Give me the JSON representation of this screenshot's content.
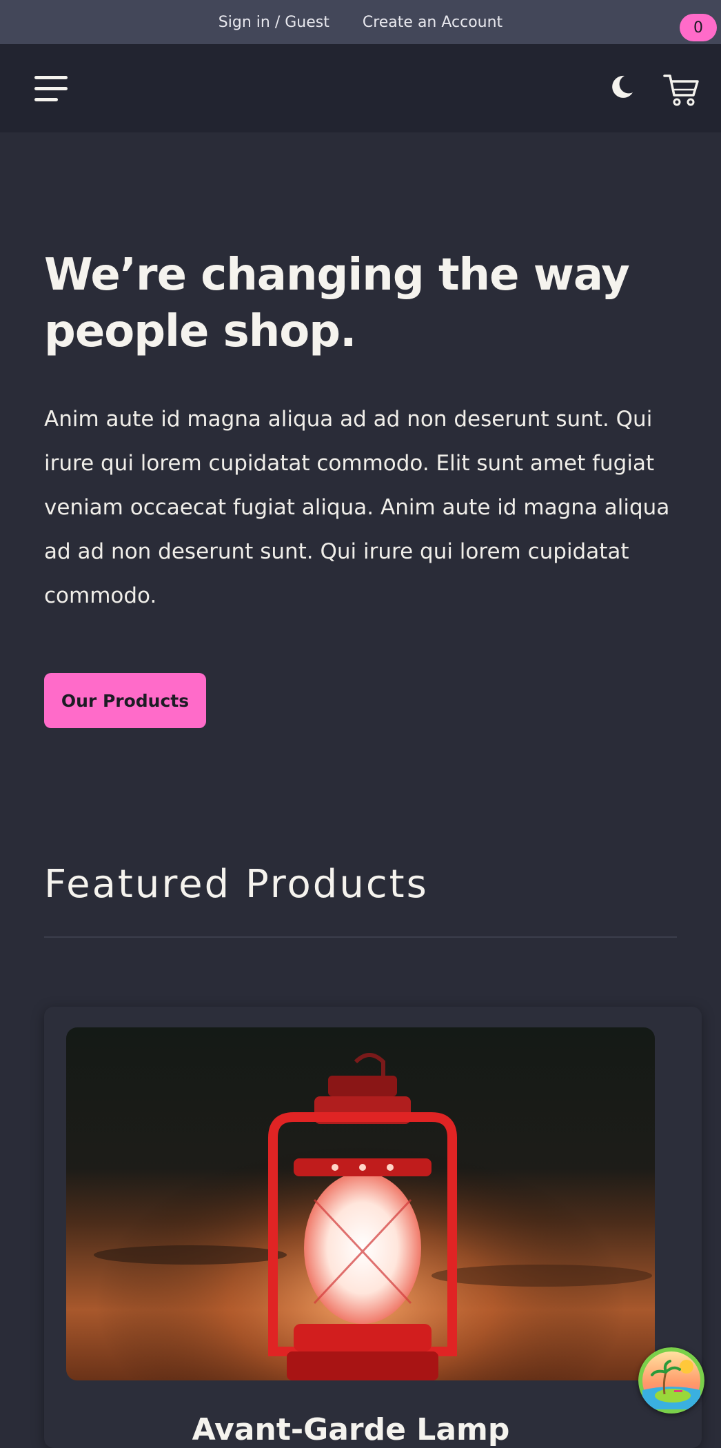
{
  "topbar": {
    "signin_label": "Sign in / Guest",
    "create_account_label": "Create an Account"
  },
  "navbar": {
    "menu_icon": "hamburger-menu-icon",
    "theme_icon": "moon-icon",
    "cart_icon": "shopping-cart-icon",
    "cart_count": "0"
  },
  "hero": {
    "title": "We’re changing the way people shop.",
    "text": "Anim aute id magna aliqua ad ad non deserunt sunt. Qui irure qui lorem cupidatat commodo. Elit sunt amet fugiat veniam occaecat fugiat aliqua. Anim aute id magna aliqua ad ad non deserunt sunt. Qui irure qui lorem cupidatat commodo.",
    "button_label": "Our Products"
  },
  "featured": {
    "title": "Featured Products",
    "products": [
      {
        "name": "Avant-Garde Lamp"
      }
    ]
  },
  "colors": {
    "background": "#2a2c38",
    "topbar": "#434759",
    "navbar": "#222430",
    "accent": "#ff6bc9"
  }
}
